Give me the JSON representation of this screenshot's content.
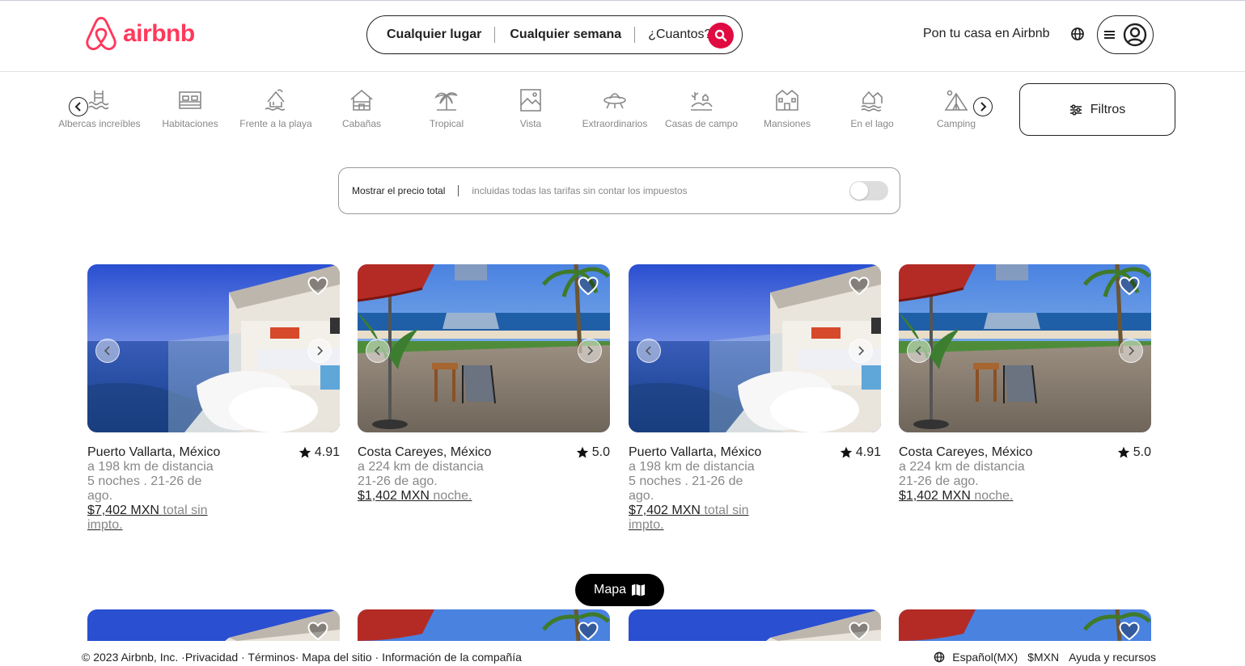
{
  "brand": {
    "name": "airbnb",
    "color": "#ff385c"
  },
  "search": {
    "where": "Cualquier lugar",
    "when": "Cualquier semana",
    "who": "¿Cuantos?",
    "accent": "#e00b41"
  },
  "header": {
    "host_link": "Pon tu casa en Airbnb"
  },
  "categories": [
    {
      "label": "Albercas increíbles",
      "icon": "pool-icon"
    },
    {
      "label": "Habitaciones",
      "icon": "bed-icon"
    },
    {
      "label": "Frente a la playa",
      "icon": "beach-icon"
    },
    {
      "label": "Cabañas",
      "icon": "cabin-icon"
    },
    {
      "label": "Tropical",
      "icon": "palm-icon"
    },
    {
      "label": "Vista",
      "icon": "view-icon"
    },
    {
      "label": "Extraordinarios",
      "icon": "ufo-icon"
    },
    {
      "label": "Casas de campo",
      "icon": "countryside-icon"
    },
    {
      "label": "Mansiones",
      "icon": "mansion-icon"
    },
    {
      "label": "En el lago",
      "icon": "lake-icon"
    },
    {
      "label": "Camping",
      "icon": "tent-icon"
    }
  ],
  "filters": {
    "label": "Filtros"
  },
  "price_toggle": {
    "label": "Mostrar el precio total",
    "hint": "incluidas todas las tarifas sin contar los impuestos",
    "enabled": false
  },
  "listings": [
    {
      "location": "Puerto Vallarta, México",
      "rating": "4.91",
      "distance": "a 198 km de distancia",
      "dates": "5 noches . 21-26 de ago.",
      "price": "$7,402 MXN",
      "price_suffix": "total sin impto.",
      "photo": "sunset"
    },
    {
      "location": "Costa Careyes, México",
      "rating": "5.0",
      "distance": "a 224 km de distancia",
      "dates": "21-26 de ago.",
      "price": "$1,402 MXN",
      "price_suffix": "noche.",
      "photo": "beach"
    },
    {
      "location": "Puerto Vallarta, México",
      "rating": "4.91",
      "distance": "a 198 km de distancia",
      "dates": "5 noches . 21-26 de ago.",
      "price": "$7,402 MXN",
      "price_suffix": "total sin impto.",
      "photo": "sunset"
    },
    {
      "location": "Costa Careyes, México",
      "rating": "5.0",
      "distance": "a 224 km de distancia",
      "dates": "21-26 de ago.",
      "price": "$1,402 MXN",
      "price_suffix": "noche.",
      "photo": "beach"
    }
  ],
  "map_button": {
    "label": "Mapa"
  },
  "footer": {
    "left": "© 2023 Airbnb, Inc. ·Privacidad · Términos· Mapa del sitio · Información de la compañía",
    "language": "Español(MX)",
    "currency": "$MXN",
    "help": "Ayuda y recursos"
  }
}
